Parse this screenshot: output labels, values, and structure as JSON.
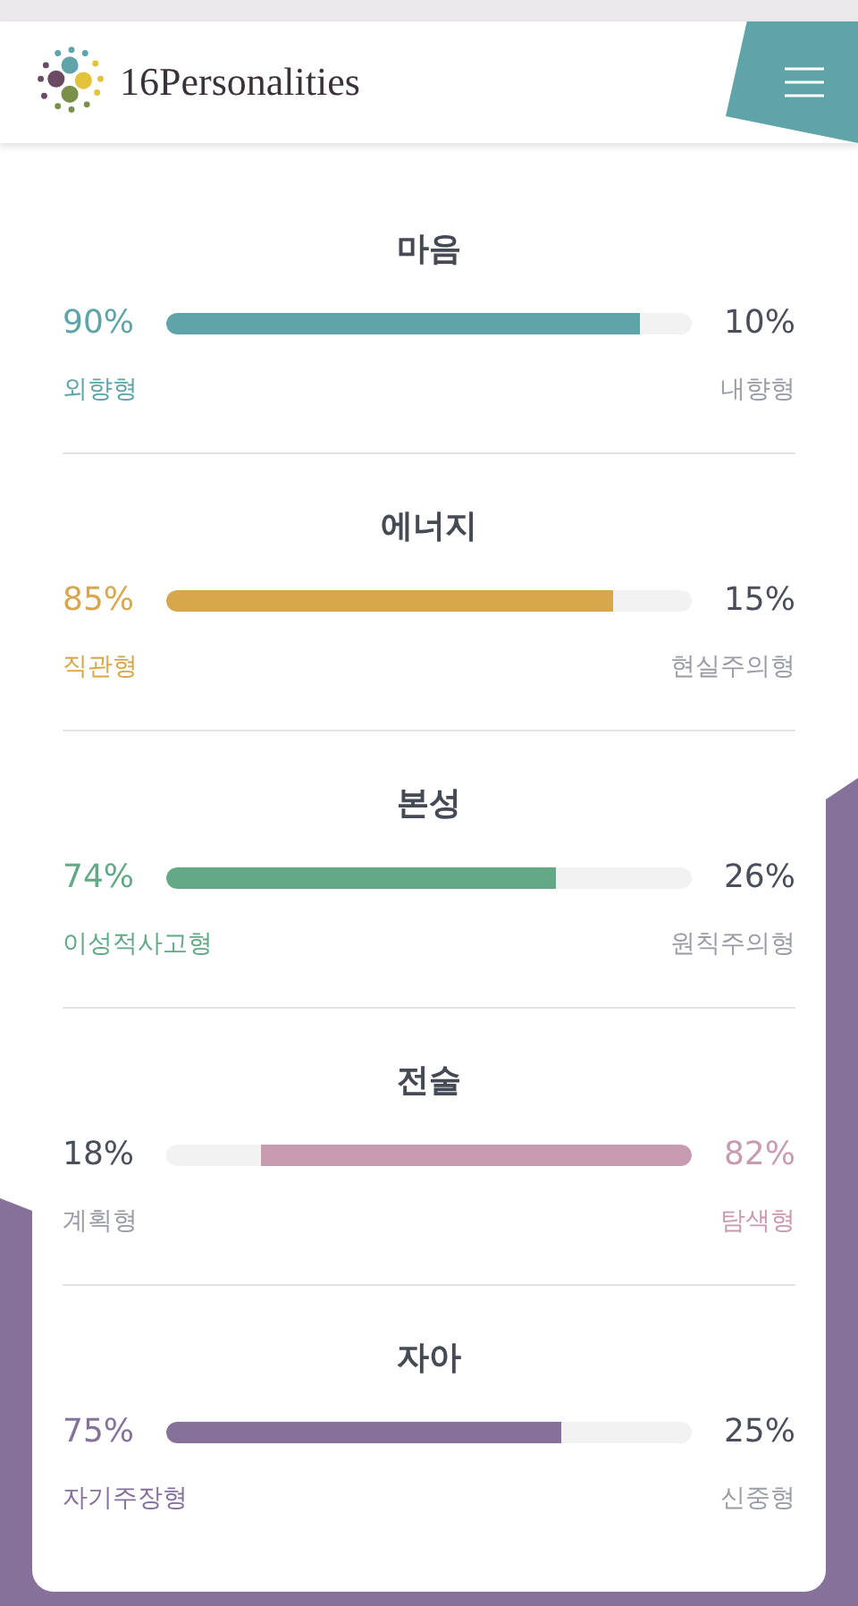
{
  "header": {
    "logo_text": "16Personalities"
  },
  "scales": [
    {
      "title": "마음",
      "left_percent": "90%",
      "right_percent": "10%",
      "left_label": "외향형",
      "right_label": "내향형",
      "kind": "left",
      "level": 0.9,
      "color": "#5ea4a8"
    },
    {
      "title": "에너지",
      "left_percent": "85%",
      "right_percent": "15%",
      "left_label": "직관형",
      "right_label": "현실주의형",
      "kind": "left",
      "level": 0.85,
      "color": "#d8a64c"
    },
    {
      "title": "본성",
      "left_percent": "74%",
      "right_percent": "26%",
      "left_label": "이성적사고형",
      "right_label": "원칙주의형",
      "kind": "left",
      "level": 0.74,
      "color": "#63a986"
    },
    {
      "title": "전술",
      "left_percent": "18%",
      "right_percent": "82%",
      "left_label": "계획형",
      "right_label": "탐색형",
      "kind": "right",
      "level": 0.82,
      "color": "#c79bb0"
    },
    {
      "title": "자아",
      "left_percent": "75%",
      "right_percent": "25%",
      "left_label": "자기주장형",
      "right_label": "신중형",
      "kind": "left",
      "level": 0.75,
      "color": "#86719a"
    }
  ]
}
